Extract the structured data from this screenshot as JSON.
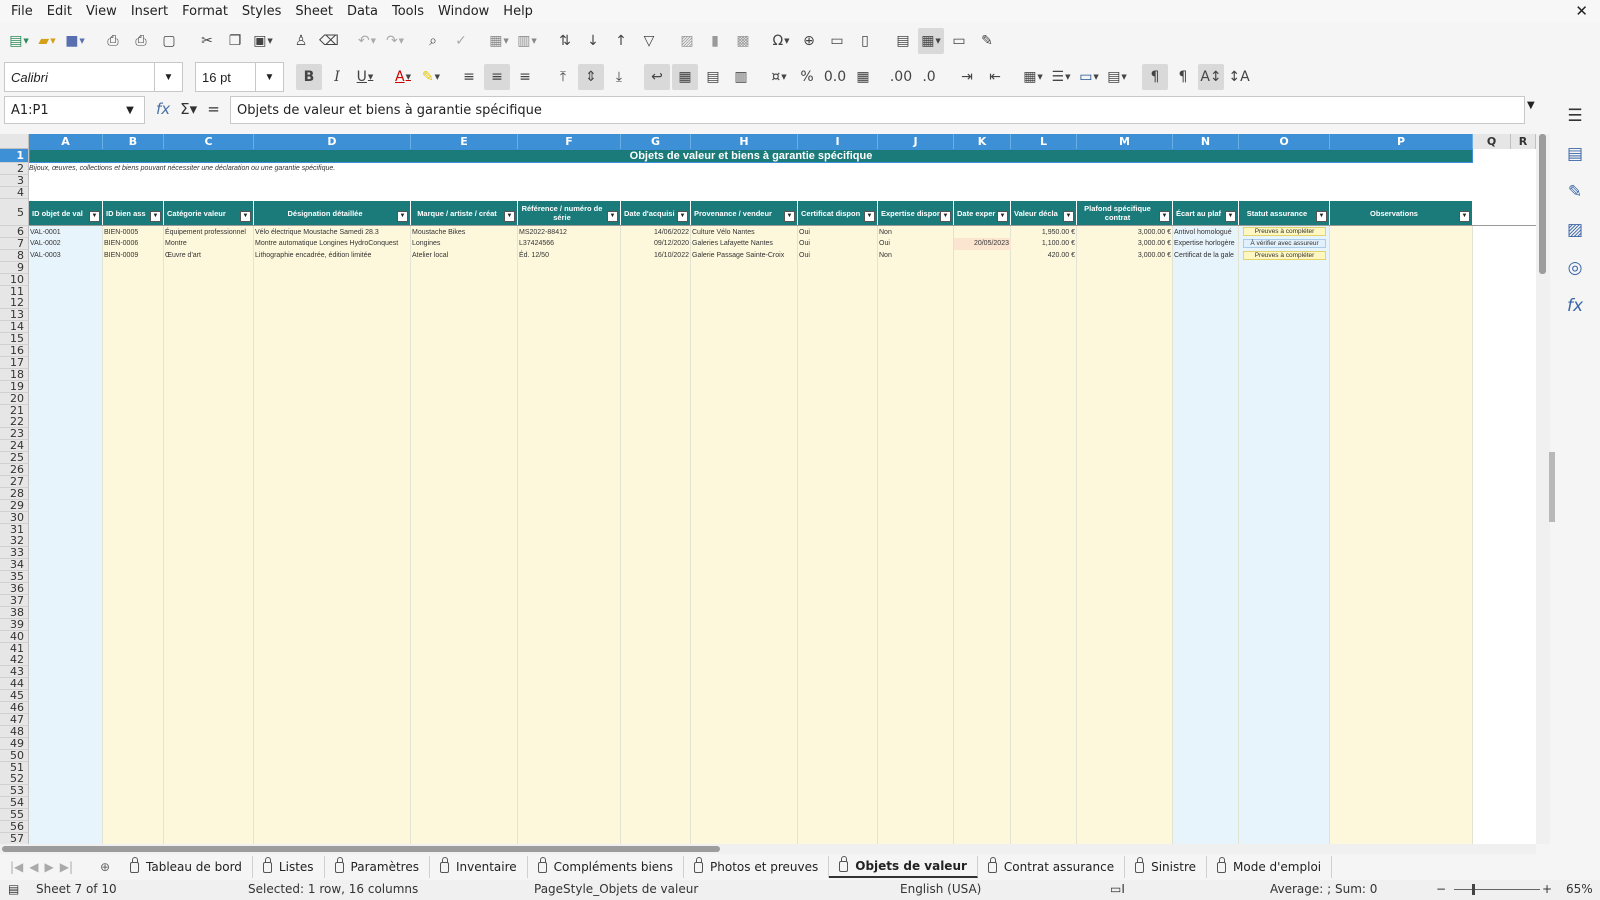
{
  "menubar": [
    "File",
    "Edit",
    "View",
    "Insert",
    "Format",
    "Styles",
    "Sheet",
    "Data",
    "Tools",
    "Window",
    "Help"
  ],
  "close_label": "✕",
  "font": {
    "name": "Calibri",
    "size": "16 pt"
  },
  "formula": {
    "cell_ref": "A1:P1",
    "content": "Objets de valeur et biens à garantie spécifique"
  },
  "columns": [
    "A",
    "B",
    "C",
    "D",
    "E",
    "F",
    "G",
    "H",
    "I",
    "J",
    "K",
    "L",
    "M",
    "N",
    "O",
    "P",
    "Q",
    "R"
  ],
  "rows": [
    "1",
    "2",
    "3",
    "4",
    "5",
    "6",
    "7",
    "8",
    "9",
    "10",
    "11",
    "12",
    "13",
    "14",
    "15",
    "16",
    "17",
    "18",
    "19",
    "20",
    "21",
    "22",
    "23",
    "24",
    "25",
    "26",
    "27",
    "28",
    "29",
    "30",
    "31",
    "32",
    "33",
    "34",
    "35",
    "36",
    "37",
    "38",
    "39",
    "40",
    "41",
    "42",
    "43",
    "44",
    "45",
    "46",
    "47",
    "48",
    "49",
    "50",
    "51",
    "52",
    "53",
    "54",
    "55",
    "56",
    "57"
  ],
  "sheet": {
    "title": "Objets de valeur et biens à garantie spécifique",
    "subtitle": "Bijoux, œuvres, collections et biens pouvant nécessiter une déclaration ou une garantie spécifique.",
    "headers": [
      "ID objet de val",
      "ID bien ass",
      "Catégorie valeur",
      "Désignation détaillée",
      "Marque / artiste / créat",
      "Référence / numéro de série",
      "Date d'acquisi",
      "Provenance / vendeur",
      "Certificat dispon",
      "Expertise dispor",
      "Date exper",
      "Valeur décla",
      "Plafond spécifique contrat",
      "Écart au plaf",
      "Statut assurance",
      "Observations"
    ],
    "rows": [
      [
        "VAL-0001",
        "BIEN-0005",
        "Équipement professionnel",
        "Vélo électrique Moustache Samedi 28.3",
        "Moustache Bikes",
        "MS2022-88412",
        "14/06/2022",
        "Culture Vélo Nantes",
        "Oui",
        "Non",
        "",
        "1,950.00 €",
        "3,000.00 €",
        "Antivol homologué",
        "Preuves à compléter",
        ""
      ],
      [
        "VAL-0002",
        "BIEN-0006",
        "Montre",
        "Montre automatique Longines HydroConquest",
        "Longines",
        "L37424566",
        "09/12/2020",
        "Galeries Lafayette Nantes",
        "Oui",
        "Oui",
        "20/05/2023",
        "1,100.00 €",
        "3,000.00 €",
        "Expertise horlogère",
        "À vérifier avec assureur",
        ""
      ],
      [
        "VAL-0003",
        "BIEN-0009",
        "Œuvre d'art",
        "Lithographie encadrée, édition limitée",
        "Atelier local",
        "Éd. 12/50",
        "16/10/2022",
        "Galerie Passage Sainte-Croix",
        "Oui",
        "Non",
        "",
        "420.00 €",
        "3,000.00 €",
        "Certificat de la gale",
        "Preuves à compléter",
        ""
      ]
    ]
  },
  "tabs": [
    "Tableau de bord",
    "Listes",
    "Paramètres",
    "Inventaire",
    "Compléments biens",
    "Photos et preuves",
    "Objets de valeur",
    "Contrat assurance",
    "Sinistre",
    "Mode d'emploi"
  ],
  "active_tab": "Objets de valeur",
  "status": {
    "sheet": "Sheet 7 of 10",
    "selection": "Selected: 1 row, 16 columns",
    "page_style": "PageStyle_Objets de valeur",
    "language": "English (USA)",
    "summary": "Average: ; Sum: 0",
    "zoom": "65%"
  },
  "colors": {
    "header_teal": "#1b7a7a",
    "selection_blue": "#3d8fd6",
    "cell_yellow": "#fdf8dc",
    "cell_blue": "#e8f4fb"
  }
}
